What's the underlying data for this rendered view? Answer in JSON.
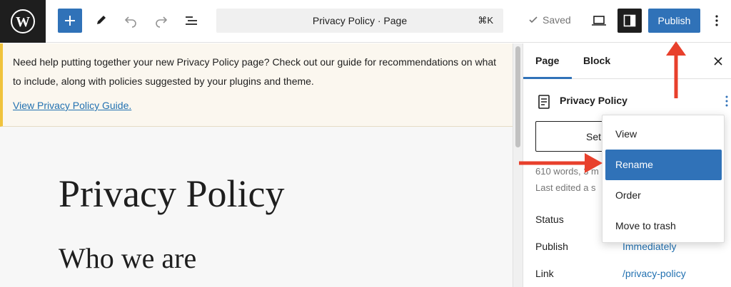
{
  "topbar": {
    "logo_icon": "wordpress-logo-icon",
    "add_icon": "plus-icon",
    "tools_icon": "pencil-icon",
    "undo_icon": "undo-icon",
    "redo_icon": "redo-icon",
    "outline_icon": "list-view-icon",
    "command_title": "Privacy Policy · Page",
    "command_shortcut": "⌘K",
    "saved_label": "Saved",
    "preview_icon": "laptop-icon",
    "settings_icon": "sidebar-toggle-icon",
    "publish_label": "Publish",
    "options_icon": "more-vertical-icon"
  },
  "notice": {
    "message": "Need help putting together your new Privacy Policy page? Check out our guide for recommendations on what to include, along with policies suggested by your plugins and theme.",
    "link": "View Privacy Policy Guide."
  },
  "editor": {
    "title": "Privacy Policy",
    "heading": "Who we are"
  },
  "sidebar": {
    "tabs": [
      "Page",
      "Block"
    ],
    "close_icon": "close-icon",
    "doc_icon": "page-icon",
    "doc_title": "Privacy Policy",
    "set_button_label": "Set",
    "words": "610 words, 3 m",
    "last_edited": "Last edited a s",
    "rows": [
      {
        "label": "Status",
        "value": ""
      },
      {
        "label": "Publish",
        "value": "Immediately"
      },
      {
        "label": "Link",
        "value": "/privacy-policy"
      }
    ]
  },
  "menu": {
    "items": [
      "View",
      "Rename",
      "Order",
      "Move to trash"
    ],
    "active_index": 1
  },
  "colors": {
    "accent": "#3072b8",
    "arrow": "#e8402c",
    "notice_bg": "#fbf7ef",
    "notice_border": "#f0c33c"
  }
}
